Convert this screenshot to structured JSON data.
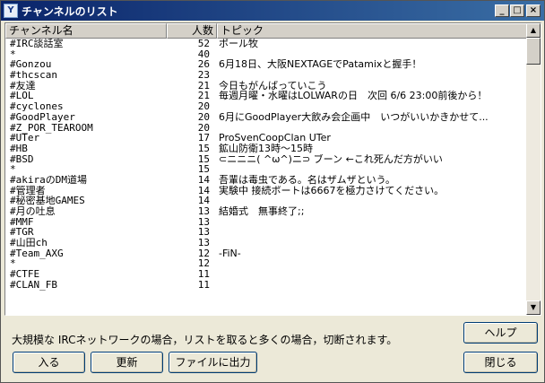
{
  "window": {
    "title": "チャンネルのリスト",
    "icon_label": "Y"
  },
  "titlebar_buttons": {
    "minimize": "_",
    "maximize": "□",
    "close": "×"
  },
  "columns": {
    "name": "チャンネル名",
    "users": "人数",
    "topic": "トピック"
  },
  "rows": [
    {
      "name": "#IRC談話室",
      "users": "52",
      "topic": "ポール牧"
    },
    {
      "name": "*",
      "users": "40",
      "topic": ""
    },
    {
      "name": "#Gonzou",
      "users": "26",
      "topic": "6月18日、大阪NEXTAGEでPatamixと握手！"
    },
    {
      "name": "#thcscan",
      "users": "23",
      "topic": ""
    },
    {
      "name": "#友達",
      "users": "21",
      "topic": "今日もがんばっていこう"
    },
    {
      "name": "#LOL",
      "users": "21",
      "topic": "毎週月曜・水曜はLOLWARの日　次回 6/6 23:00前後から！"
    },
    {
      "name": "#cyclones",
      "users": "20",
      "topic": ""
    },
    {
      "name": "#GoodPlayer",
      "users": "20",
      "topic": "6月にGoodPlayer大飲み会企画中　いつがいいかきかせて..."
    },
    {
      "name": "#Z_POR_TEAROOM",
      "users": "20",
      "topic": ""
    },
    {
      "name": "#UTer",
      "users": "17",
      "topic": "ProSvenCoopClan UTer"
    },
    {
      "name": "#HB",
      "users": "15",
      "topic": "鉱山防衛13時〜15時"
    },
    {
      "name": "#BSD",
      "users": "15",
      "topic": "⊂ニニニ( ^ω^)ニ⊃ ブーン ←これ死んだ方がいい"
    },
    {
      "name": "*",
      "users": "15",
      "topic": ""
    },
    {
      "name": "#akiraのDM道場",
      "users": "14",
      "topic": "吾輩は毒虫である。名はザムザという。"
    },
    {
      "name": "#管理者",
      "users": "14",
      "topic": "実験中 接続ポートは6667を極力さけてください。"
    },
    {
      "name": "#秘密基地GAMES",
      "users": "14",
      "topic": ""
    },
    {
      "name": "#月の吐息",
      "users": "13",
      "topic": "結婚式　無事終了;;"
    },
    {
      "name": "#MMF",
      "users": "13",
      "topic": ""
    },
    {
      "name": "#TGR",
      "users": "13",
      "topic": ""
    },
    {
      "name": "#山田ch",
      "users": "13",
      "topic": ""
    },
    {
      "name": "#Team_AXG",
      "users": "12",
      "topic": "-FiN-"
    },
    {
      "name": "*",
      "users": "12",
      "topic": ""
    },
    {
      "name": "#CTFE",
      "users": "11",
      "topic": ""
    },
    {
      "name": "#CLAN_FB",
      "users": "11",
      "topic": ""
    }
  ],
  "notice": "大規模な IRCネットワークの場合，リストを取ると多くの場合，切断されます。",
  "buttons": {
    "help": "ヘルプ",
    "join": "入る",
    "refresh": "更新",
    "export": "ファイルに出力",
    "close": "閉じる"
  },
  "icons": {
    "scroll_up": "up-arrow",
    "scroll_down": "down-arrow"
  }
}
